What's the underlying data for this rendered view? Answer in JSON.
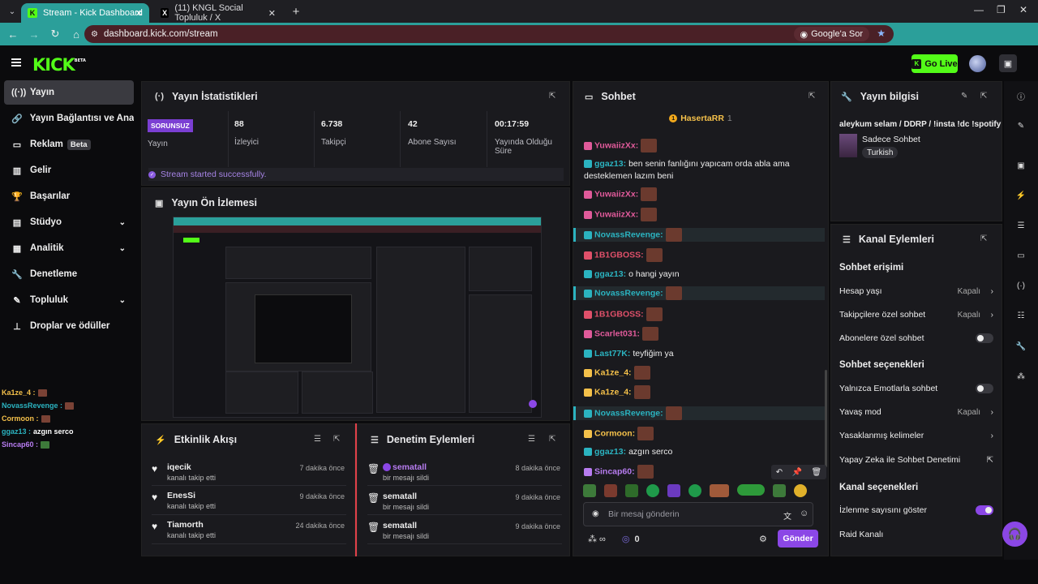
{
  "browser": {
    "tabs": [
      {
        "title": "Stream - Kick Dashboard",
        "active": true
      },
      {
        "title": "(11) KNGL Social Topluluk / X",
        "active": false
      }
    ],
    "url": "dashboard.kick.com/stream",
    "ask_label": "Google'a Sor"
  },
  "topnav": {
    "logo": "KICK",
    "logo_beta": "BETA",
    "go_live": "Go Live"
  },
  "sidebar": {
    "items": [
      {
        "label": "Yayın",
        "icon": "broadcast-icon"
      },
      {
        "label": "Yayın Bağlantısı ve Anahtar",
        "icon": "link-icon"
      },
      {
        "label": "Reklam",
        "icon": "ad-icon",
        "badge": "Beta"
      },
      {
        "label": "Gelir",
        "icon": "revenue-icon"
      },
      {
        "label": "Başarılar",
        "icon": "trophy-icon"
      },
      {
        "label": "Stüdyo",
        "icon": "studio-icon"
      },
      {
        "label": "Analitik",
        "icon": "analytics-icon"
      },
      {
        "label": "Denetleme",
        "icon": "wrench-icon"
      },
      {
        "label": "Topluluk",
        "icon": "community-icon"
      },
      {
        "label": "Droplar ve ödüller",
        "icon": "drops-icon"
      }
    ],
    "mini_chat": [
      {
        "user": "Ka1ze_4 :",
        "color": "#f4c04a",
        "text": ""
      },
      {
        "user": "NovassRevenge :",
        "color": "#2bb3c0",
        "text": ""
      },
      {
        "user": "Cormoon :",
        "color": "#f4c04a",
        "text": ""
      },
      {
        "user": "ggaz13 :",
        "color": "#2bb3c0",
        "text": "azgın serco"
      },
      {
        "user": "Sincap60 :",
        "color": "#b77cf0",
        "text": ""
      }
    ]
  },
  "stats": {
    "title": "Yayın İstatistikleri",
    "status_badge": "SORUNSUZ",
    "items": [
      {
        "value": "",
        "label": "Yayın"
      },
      {
        "value": "88",
        "label": "İzleyici"
      },
      {
        "value": "6.738",
        "label": "Takipçi"
      },
      {
        "value": "42",
        "label": "Abone Sayısı"
      },
      {
        "value": "00:17:59",
        "label": "Yayında Olduğu Süre"
      }
    ],
    "success_msg": "Stream started successfully."
  },
  "preview": {
    "title": "Yayın Ön İzlemesi"
  },
  "events": {
    "title": "Etkinlik Akışı",
    "rows": [
      {
        "name": "iqecik",
        "sub": "kanalı takip etti",
        "time": "7 dakika önce"
      },
      {
        "name": "EnesSi",
        "sub": "kanalı takip etti",
        "time": "9 dakika önce"
      },
      {
        "name": "Tiamorth",
        "sub": "kanalı takip etti",
        "time": "24 dakika önce"
      }
    ]
  },
  "moderation": {
    "title": "Denetim Eylemleri",
    "rows": [
      {
        "name": "sematall",
        "sub": "bir mesajı sildi",
        "time": "8 dakika önce"
      },
      {
        "name": "sematall",
        "sub": "bir mesajı sildi",
        "time": "9 dakika önce"
      },
      {
        "name": "sematall",
        "sub": "bir mesajı sildi",
        "time": "9 dakika önce"
      }
    ]
  },
  "chat": {
    "title": "Sohbet",
    "pinned_user": "HasertaRR",
    "pinned_count": "1",
    "messages": [
      {
        "user": "YuwaiizXx:",
        "color": "#e05a9a",
        "text": "",
        "emote": true,
        "hl": false
      },
      {
        "user": "ggaz13:",
        "color": "#2bb3c0",
        "text": "ben senin fanlığını yapıcam orda abla ama desteklemen lazım beni",
        "emote": false,
        "hl": false
      },
      {
        "user": "YuwaiizXx:",
        "color": "#e05a9a",
        "text": "",
        "emote": true,
        "hl": false
      },
      {
        "user": "YuwaiizXx:",
        "color": "#e05a9a",
        "text": "",
        "emote": true,
        "hl": false
      },
      {
        "user": "NovassRevenge:",
        "color": "#2bb3c0",
        "text": "",
        "emote": true,
        "hl": true
      },
      {
        "user": "1B1GBOSS:",
        "color": "#e0506a",
        "text": "",
        "emote": true,
        "hl": false
      },
      {
        "user": "ggaz13:",
        "color": "#2bb3c0",
        "text": "o hangi yayın",
        "emote": false,
        "hl": false
      },
      {
        "user": "NovassRevenge:",
        "color": "#2bb3c0",
        "text": "",
        "emote": true,
        "hl": true
      },
      {
        "user": "1B1GBOSS:",
        "color": "#e0506a",
        "text": "",
        "emote": true,
        "hl": false
      },
      {
        "user": "Scarlet031:",
        "color": "#e05a9a",
        "text": "",
        "emote": true,
        "hl": false
      },
      {
        "user": "Last77K:",
        "color": "#2bb3c0",
        "text": "teyfiğim ya",
        "emote": false,
        "hl": false
      },
      {
        "user": "Ka1ze_4:",
        "color": "#f4c04a",
        "text": "",
        "emote": true,
        "hl": false
      },
      {
        "user": "Ka1ze_4:",
        "color": "#f4c04a",
        "text": "",
        "emote": true,
        "hl": false
      },
      {
        "user": "NovassRevenge:",
        "color": "#2bb3c0",
        "text": "",
        "emote": true,
        "hl": true
      },
      {
        "user": "Cormoon:",
        "color": "#f4c04a",
        "text": "",
        "emote": true,
        "hl": false
      },
      {
        "user": "ggaz13:",
        "color": "#2bb3c0",
        "text": "azgın serco",
        "emote": false,
        "hl": false
      },
      {
        "user": "Sincap60:",
        "color": "#b77cf0",
        "text": "",
        "emote": true,
        "hl": false
      }
    ],
    "input_placeholder": "Bir mesaj gönderin",
    "infinity": "∞",
    "points": "0",
    "send_label": "Gönder"
  },
  "stream_info": {
    "title": "Yayın bilgisi",
    "stream_title": "aleykum selam / DDRP / !insta !dc !spotify",
    "category": "Sadece Sohbet",
    "language": "Turkish"
  },
  "channel_actions": {
    "title": "Kanal Eylemleri",
    "chat_access_header": "Sohbet erişimi",
    "account_age": {
      "label": "Hesap yaşı",
      "value": "Kapalı"
    },
    "followers_only": {
      "label": "Takipçilere özel sohbet",
      "value": "Kapalı"
    },
    "subs_only": {
      "label": "Abonelere özel sohbet"
    },
    "chat_options_header": "Sohbet seçenekleri",
    "emotes_only": {
      "label": "Yalnızca Emotlarla sohbet"
    },
    "slow_mode": {
      "label": "Yavaş mod",
      "value": "Kapalı"
    },
    "banned_words": {
      "label": "Yasaklanmış kelimeler"
    },
    "ai_moderation": {
      "label": "Yapay Zeka ile Sohbet Denetimi"
    },
    "channel_options_header": "Kanal seçenekleri",
    "show_viewers": {
      "label": "İzlenme sayısını göster"
    },
    "raid": {
      "label": "Raid Kanalı"
    }
  },
  "colors": {
    "accent": "#53fc18",
    "purple": "#8b47e6",
    "teal": "#2b9f9a"
  }
}
